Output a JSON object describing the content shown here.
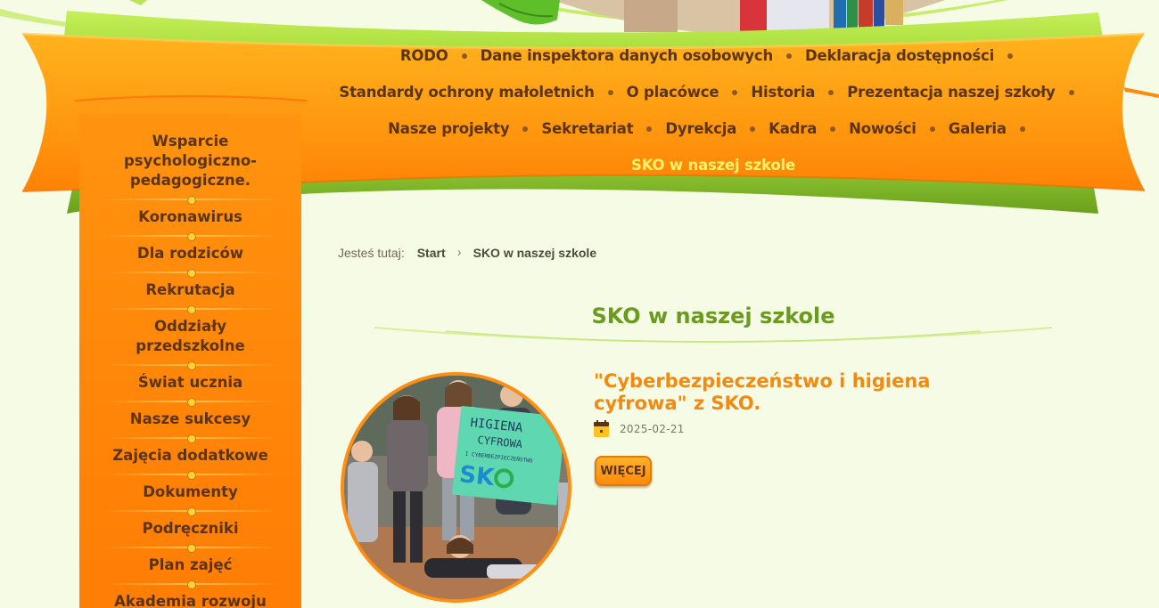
{
  "top_nav": {
    "rows": [
      [
        "RODO",
        "Dane inspektora danych osobowych",
        "Deklaracja dostępności"
      ],
      [
        "Standardy ochrony małoletnich",
        "O placówce",
        "Historia",
        "Prezentacja naszej szkoły"
      ],
      [
        "Nasze projekty",
        "Sekretariat",
        "Dyrekcja",
        "Kadra",
        "Nowości",
        "Galeria"
      ],
      [
        "SKO w naszej szkole"
      ]
    ],
    "active": "SKO w naszej szkole"
  },
  "sidebar": {
    "items": [
      "Wsparcie psychologiczno-pedagogiczne.",
      "Koronawirus",
      "Dla rodziców",
      "Rekrutacja",
      "Oddziały przedszkolne",
      "Świat ucznia",
      "Nasze sukcesy",
      "Zajęcia dodatkowe",
      "Dokumenty",
      "Podręczniki",
      "Plan zajęć",
      "Akademia rozwoju"
    ]
  },
  "breadcrumb": {
    "prefix": "Jesteś tutaj:",
    "items": [
      "Start",
      "SKO w naszej szkole"
    ]
  },
  "page": {
    "title": "SKO w naszej szkole"
  },
  "article": {
    "title": "\"Cyberbezpieczeństwo i higiena cyfrowa\" z SKO.",
    "date": "2025-02-21",
    "more_label": "WIĘCEJ",
    "poster_text": "HIGIENA CYFROWA I CYBERBEZPIECZEŃSTWO SKO"
  },
  "colors": {
    "background": "#f6fbe6",
    "banner_orange": "#ff8c0a",
    "banner_green": "#7fb52a",
    "title_green": "#6a9a1e",
    "article_orange": "#f28a12",
    "text_brown": "#5b3414",
    "active_yellow": "#fff36a"
  }
}
